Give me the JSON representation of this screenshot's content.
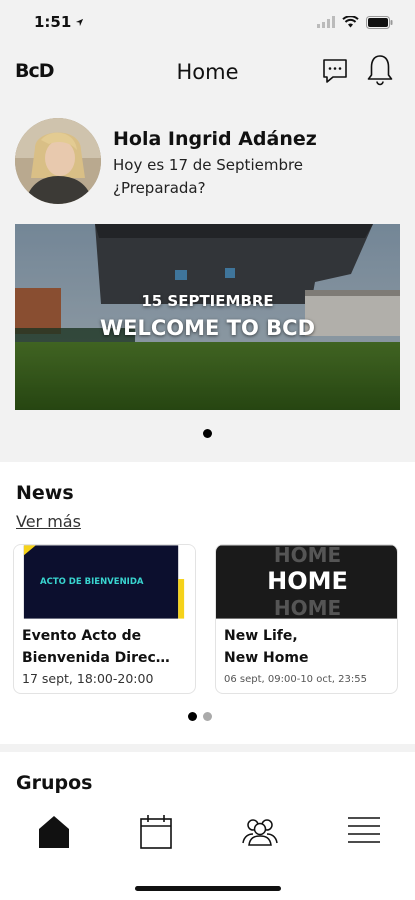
{
  "status_bar": {
    "time": "1:51"
  },
  "header": {
    "logo": "BcD",
    "title": "Home"
  },
  "greeting": {
    "name": "Hola Ingrid Adánez",
    "date_line": "Hoy es 17 de Septiembre",
    "question": "¿Preparada?"
  },
  "banner": {
    "date": "15 SEPTIEMBRE",
    "title": "WELCOME TO BCD",
    "page_index": 1,
    "page_count": 1
  },
  "news": {
    "title": "News",
    "more_link": "Ver más",
    "cards": [
      {
        "image_text": "ACTO DE BIENVENIDA",
        "title_line1": "Evento Acto de",
        "title_line2": "Bienvenida Direc…",
        "date": "17 sept, 18:00-20:00"
      },
      {
        "image_text": [
          "HOME",
          "HOME",
          "HOME"
        ],
        "title_line1": "New Life,",
        "title_line2": "New Home",
        "date": "06 sept, 09:00-10 oct, 23:55"
      }
    ],
    "page_index": 1,
    "page_count": 2
  },
  "groups": {
    "title": "Grupos"
  },
  "tabbar": {
    "items": [
      "home-icon",
      "calendar-icon",
      "people-icon",
      "menu-icon"
    ],
    "active": "home-icon"
  },
  "colors": {
    "card1_bg": "#0c0f2e",
    "card1_text": "#39d4cf",
    "card1_accent": "#f5d21a",
    "card2_bg": "#1a1a1a"
  }
}
